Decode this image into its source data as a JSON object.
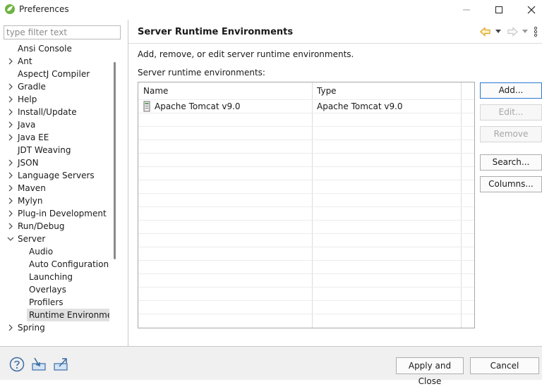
{
  "window": {
    "title": "Preferences",
    "controls": {
      "minimize": "—",
      "maximize": "☐",
      "close": "✕"
    }
  },
  "sidebar": {
    "filter_placeholder": "type filter text",
    "items": [
      {
        "label": "Ansi Console",
        "expandable": false,
        "level": 0
      },
      {
        "label": "Ant",
        "expandable": true,
        "level": 0
      },
      {
        "label": "AspectJ Compiler",
        "expandable": false,
        "level": 0
      },
      {
        "label": "Gradle",
        "expandable": true,
        "level": 0
      },
      {
        "label": "Help",
        "expandable": true,
        "level": 0
      },
      {
        "label": "Install/Update",
        "expandable": true,
        "level": 0
      },
      {
        "label": "Java",
        "expandable": true,
        "level": 0
      },
      {
        "label": "Java EE",
        "expandable": true,
        "level": 0
      },
      {
        "label": "JDT Weaving",
        "expandable": false,
        "level": 0
      },
      {
        "label": "JSON",
        "expandable": true,
        "level": 0
      },
      {
        "label": "Language Servers",
        "expandable": true,
        "level": 0
      },
      {
        "label": "Maven",
        "expandable": true,
        "level": 0
      },
      {
        "label": "Mylyn",
        "expandable": true,
        "level": 0
      },
      {
        "label": "Plug-in Development",
        "expandable": true,
        "level": 0
      },
      {
        "label": "Run/Debug",
        "expandable": true,
        "level": 0
      },
      {
        "label": "Server",
        "expandable": true,
        "expanded": true,
        "level": 0
      },
      {
        "label": "Audio",
        "expandable": false,
        "level": 1
      },
      {
        "label": "Auto Configuration",
        "expandable": false,
        "level": 1
      },
      {
        "label": "Launching",
        "expandable": false,
        "level": 1
      },
      {
        "label": "Overlays",
        "expandable": false,
        "level": 1
      },
      {
        "label": "Profilers",
        "expandable": false,
        "level": 1
      },
      {
        "label": "Runtime Environmen",
        "expandable": false,
        "level": 1,
        "selected": true
      },
      {
        "label": "Spring",
        "expandable": true,
        "level": 0
      }
    ]
  },
  "main": {
    "title": "Server Runtime Environments",
    "description": "Add, remove, or edit server runtime environments.",
    "list_label": "Server runtime environments:",
    "table": {
      "columns": [
        "Name",
        "Type"
      ],
      "rows": [
        {
          "name": "Apache Tomcat v9.0",
          "type": "Apache Tomcat v9.0",
          "checked": false
        }
      ]
    },
    "buttons": {
      "add": "Add...",
      "edit": "Edit...",
      "remove": "Remove",
      "search": "Search...",
      "columns": "Columns..."
    },
    "nav": {
      "back_icon": "back-arrow-icon",
      "forward_icon": "forward-arrow-icon",
      "menu_icon": "view-menu-icon"
    }
  },
  "footer": {
    "apply_close": "Apply and Close",
    "cancel": "Cancel",
    "icons": [
      "help-icon",
      "import-icon",
      "export-icon"
    ]
  },
  "colors": {
    "accent": "#2a78d4",
    "back_arrow": "#e0a020",
    "selection": "#e0e0e0"
  }
}
